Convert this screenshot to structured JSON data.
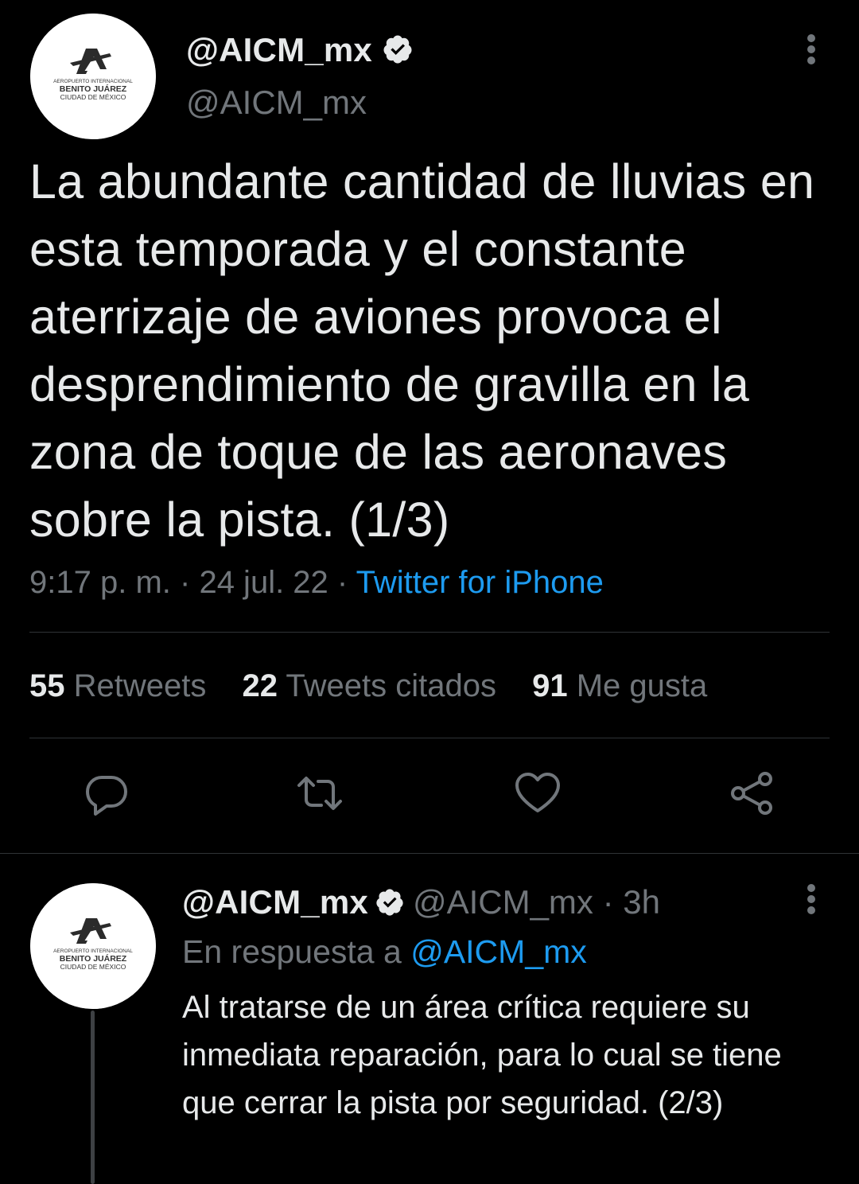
{
  "colors": {
    "background": "#000000",
    "text_primary": "#e7e9ea",
    "text_secondary": "#71767b",
    "accent": "#1d9bf0",
    "divider": "#2f3336"
  },
  "main_tweet": {
    "display_name": "@AICM_mx",
    "handle": "@AICM_mx",
    "avatar_logo": {
      "line1": "AEROPUERTO INTERNACIONAL",
      "line2": "BENITO JUÁREZ",
      "line3": "CIUDAD DE MÉXICO"
    },
    "text": "La abundante cantidad de lluvias en esta temporada y el constante aterrizaje de aviones provoca el desprendimiento de gravilla en la zona de toque de las aeronaves sobre la pista. (1/3)",
    "time": "9:17 p. m.",
    "separator": "·",
    "date": "24 jul. 22",
    "source": "Twitter for iPhone",
    "stats": {
      "retweets_count": "55",
      "retweets_label": "Retweets",
      "quotes_count": "22",
      "quotes_label": "Tweets citados",
      "likes_count": "91",
      "likes_label": "Me gusta"
    },
    "actions": {
      "reply_icon": "reply-icon",
      "retweet_icon": "retweet-icon",
      "like_icon": "heart-icon",
      "share_icon": "share-icon"
    }
  },
  "reply_tweet": {
    "display_name": "@AICM_mx",
    "handle": "@AICM_mx",
    "separator": "·",
    "time_ago": "3h",
    "reply_prefix": "En respuesta a",
    "reply_mention": "@AICM_mx",
    "text": "Al tratarse de un área crítica requiere su inmediata reparación, para lo cual se tiene que cerrar la pista por seguridad. (2/3)"
  }
}
